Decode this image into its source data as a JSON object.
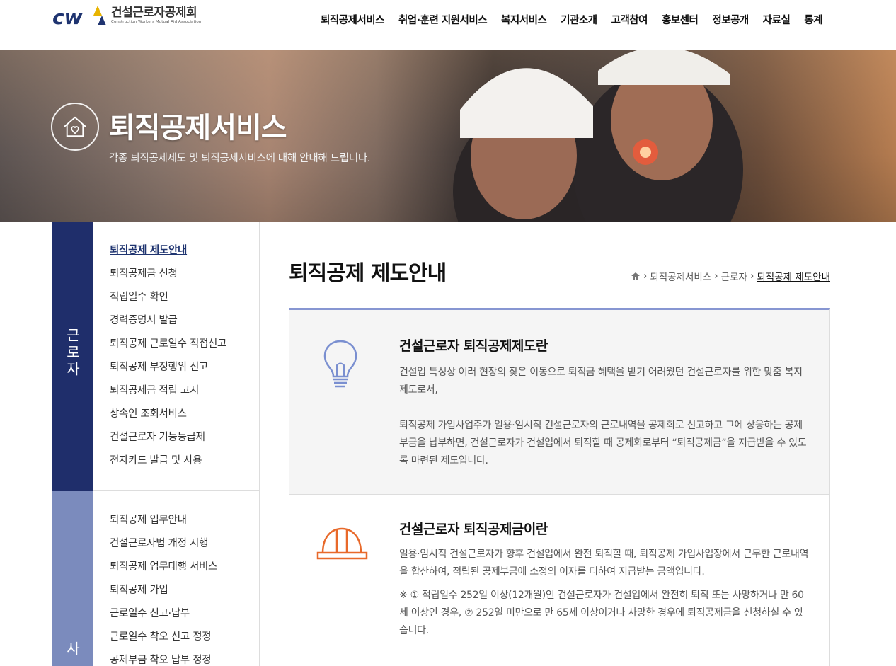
{
  "logo": {
    "name_ko": "건설근로자공제회",
    "name_en": "Construction Workers Mutual Aid Association",
    "mark": "CW"
  },
  "gnb": [
    "퇴직공제서비스",
    "취업·훈련 지원서비스",
    "복지서비스",
    "기관소개",
    "고객참여",
    "홍보센터",
    "정보공개",
    "자료실",
    "통계"
  ],
  "banner": {
    "title": "퇴직공제서비스",
    "desc": "각종 퇴직공제제도 및 퇴직공제서비스에 대해 안내해 드립니다.",
    "icon": "house-heart-icon"
  },
  "sidebar": {
    "group1": {
      "tab": "근로자",
      "items": [
        "퇴직공제 제도안내",
        "퇴직공제금 신청",
        "적립일수 확인",
        "경력증명서 발급",
        "퇴직공제 근로일수 직접신고",
        "퇴직공제 부정행위 신고",
        "퇴직공제금 적립 고지",
        "상속인 조회서비스",
        "건설근로자 기능등급제",
        "전자카드 발급 및 사용"
      ]
    },
    "group2": {
      "tab": "사",
      "items": [
        "퇴직공제 업무안내",
        "건설근로자법 개정 시행",
        "퇴직공제 업무대행 서비스",
        "퇴직공제 가입",
        "근로일수 신고·납부",
        "근로일수 착오 신고 정정",
        "공제부금 착오 납부 정정"
      ]
    }
  },
  "content": {
    "title": "퇴직공제 제도안내",
    "breadcrumb": [
      "퇴직공제서비스",
      "근로자",
      "퇴직공제 제도안내"
    ],
    "section1": {
      "icon": "lightbulb-icon",
      "title": "건설근로자 퇴직공제제도란",
      "p1": "건설업 특성상 여러 현장의 잦은 이동으로 퇴직금 혜택을 받기 어려웠던 건설근로자를 위한 맞춤 복지제도로서,",
      "p2": "퇴직공제 가입사업주가 일용·임시직 건설근로자의 근로내역을 공제회로 신고하고 그에 상응하는 공제부금을 납부하면, 건설근로자가 건설업에서 퇴직할 때 공제회로부터 “퇴직공제금”을 지급받을 수 있도록 마련된 제도입니다."
    },
    "section2": {
      "icon": "hardhat-icon",
      "title": "건설근로자 퇴직공제금이란",
      "p1": "일용·임시직 건설근로자가 향후 건설업에서 완전 퇴직할 때, 퇴직공제 가입사업장에서 근무한 근로내역을 합산하여, 적립된 공제부금에 소정의 이자를 더하여 지급받는 금액입니다.",
      "note": "※ ① 적립일수 252일 이상(12개월)인 건설근로자가 건설업에서 완전히 퇴직 또는 사망하거나 만 60세 이상인 경우, ② 252일 미만으로 만 65세 이상이거나 사망한 경우에 퇴직공제금을 신청하실 수 있습니다."
    }
  },
  "colors": {
    "navy": "#1f2e6b",
    "light_navy": "#7b8bbd",
    "accent_line": "#8796d2",
    "hardhat_orange": "#e8692a",
    "bulb_blue": "#7a8fd0"
  }
}
